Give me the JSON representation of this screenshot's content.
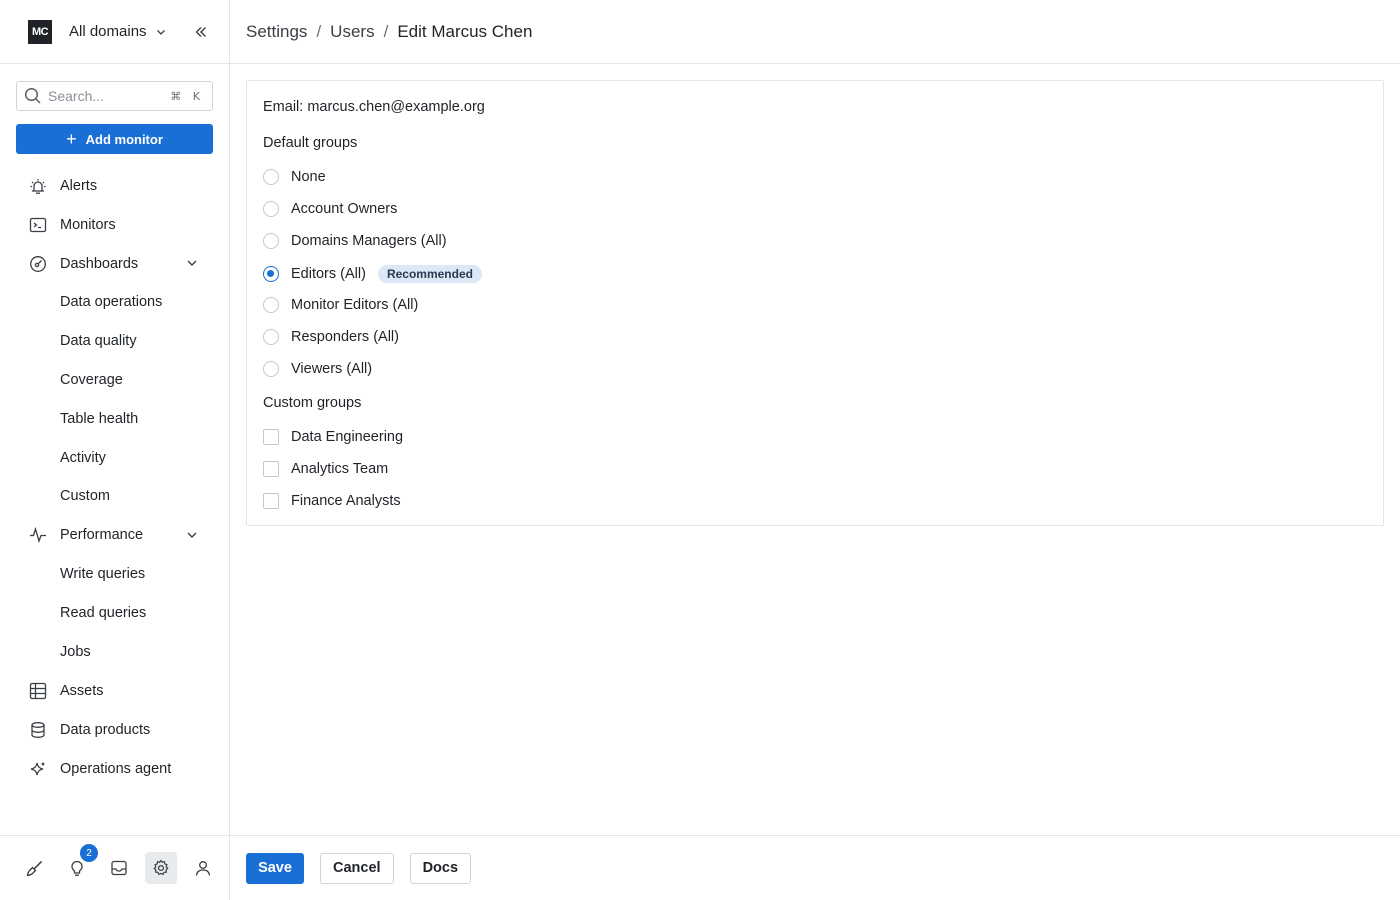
{
  "sidebar": {
    "logo_text": "MC",
    "domain": "All domains",
    "search_placeholder": "Search...",
    "search_shortcut": "⌘ K",
    "add_monitor_label": "Add monitor",
    "nav": {
      "alerts": "Alerts",
      "monitors": "Monitors",
      "dashboards": "Dashboards",
      "dashboards_sub": [
        "Data operations",
        "Data quality",
        "Coverage",
        "Table health",
        "Activity",
        "Custom"
      ],
      "performance": "Performance",
      "performance_sub": [
        "Write queries",
        "Read queries",
        "Jobs"
      ],
      "assets": "Assets",
      "data_products": "Data products",
      "operations_agent": "Operations agent"
    },
    "bottom": {
      "notifications_count": "2"
    }
  },
  "breadcrumb": [
    "Settings",
    "Users",
    "Edit Marcus Chen"
  ],
  "form": {
    "email_label": "Email: marcus.chen@example.org",
    "default_groups_title": "Default groups",
    "default_groups": [
      "None",
      "Account Owners",
      "Domains Managers (All)",
      "Editors (All)",
      "Monitor Editors (All)",
      "Responders (All)",
      "Viewers (All)"
    ],
    "selected_default_group": "Editors (All)",
    "recommended_badge": "Recommended",
    "custom_groups_title": "Custom groups",
    "custom_groups": [
      "Data Engineering",
      "Analytics Team",
      "Finance Analysts"
    ]
  },
  "footer": {
    "save": "Save",
    "cancel": "Cancel",
    "docs": "Docs"
  },
  "colors": {
    "accent": "#1a6fd6",
    "badge_bg": "#dbe8f6"
  }
}
